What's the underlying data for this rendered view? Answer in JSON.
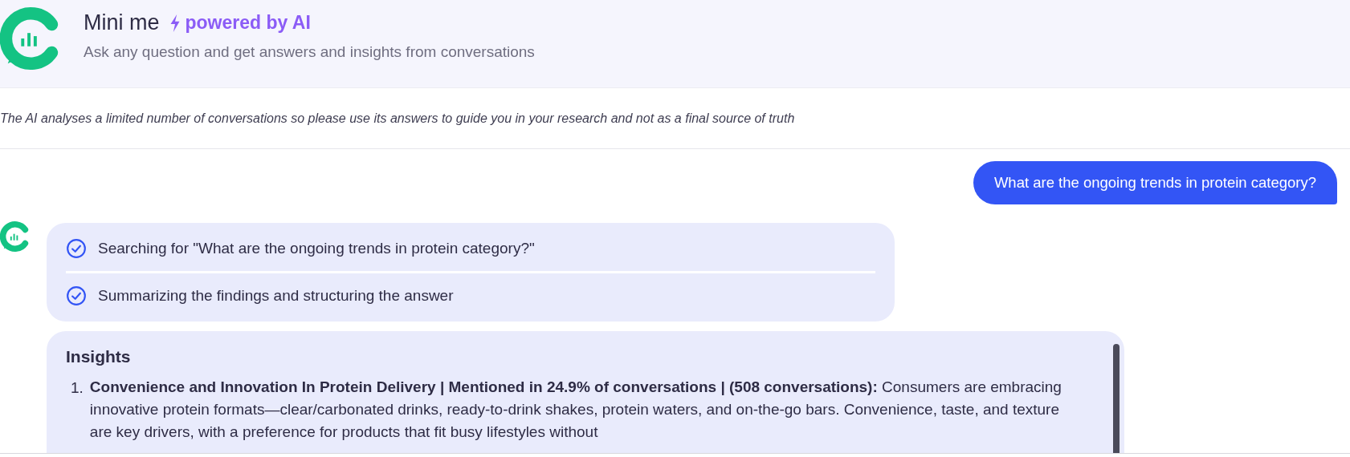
{
  "header": {
    "title": "Mini me",
    "badge": "powered by AI",
    "subtitle": "Ask any question and get answers and insights from conversations"
  },
  "disclaimer": "The AI analyses a limited number of conversations so please use its answers to guide you in your research and not as a final source of truth",
  "messages": [
    {
      "kind": "user",
      "text": "What are the ongoing trends in protein category?"
    },
    {
      "kind": "steps",
      "steps": [
        {
          "text": "Searching for \"What are the ongoing trends in protein category?\"",
          "done": true
        },
        {
          "text": "Summarizing the findings and structuring the answer",
          "done": true
        }
      ]
    },
    {
      "kind": "insights",
      "title": "Insights",
      "items": [
        {
          "number": "1.",
          "text": "**Convenience and Innovation In Protein Delivery | Mentioned in 24.9% of conversations | (508 conversations):** Consumers are embracing innovative protein formats—clear/carbonated drinks, ready-to-drink shakes, protein waters, and on-the-go bars. Convenience, taste, and texture are key drivers, with a preference for products that fit busy lifestyles without"
        }
      ]
    }
  ]
}
